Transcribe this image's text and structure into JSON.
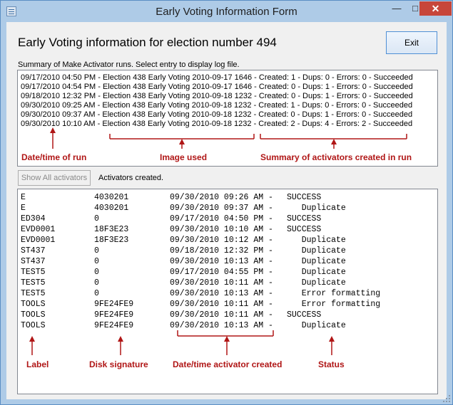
{
  "window": {
    "title": "Early Voting Information Form"
  },
  "heading": "Early Voting information for election number 494",
  "exit_label": "Exit",
  "summary_label": "Summary of Make Activator runs.  Select entry to display log file.",
  "runs": [
    "09/17/2010 04:50 PM - Election 438 Early Voting 2010-09-17 1646 - Created: 1 - Dups: 0 - Errors: 0 - Succeeded",
    "09/17/2010 04:54 PM - Election 438 Early Voting 2010-09-17 1646 - Created: 0 - Dups: 1 - Errors: 0 - Succeeded",
    "09/18/2010 12:32 PM - Election 438 Early Voting 2010-09-18 1232 - Created: 0 - Dups: 1 - Errors: 0 - Succeeded",
    "09/30/2010 09:25 AM - Election 438 Early Voting 2010-09-18 1232 - Created: 1 - Dups: 0 - Errors: 0 - Succeeded",
    "09/30/2010 09:37 AM - Election 438 Early Voting 2010-09-18 1232 - Created: 0 - Dups: 1 - Errors: 0 - Succeeded",
    "09/30/2010 10:10 AM - Election 438 Early Voting 2010-09-18 1232 - Created: 2 - Dups: 4 - Errors: 2 - Succeeded"
  ],
  "show_all_label": "Show All activators",
  "activators_label": "Activators created.",
  "activators": [
    {
      "label": "E",
      "sig": "4030201",
      "date": "09/30/2010 09:26 AM - ",
      "status": "SUCCESS"
    },
    {
      "label": "E",
      "sig": "4030201",
      "date": "09/30/2010 09:37 AM - ",
      "status": "   Duplicate"
    },
    {
      "label": "ED304",
      "sig": "0",
      "date": "09/17/2010 04:50 PM - ",
      "status": "SUCCESS"
    },
    {
      "label": "EVD0001",
      "sig": "18F3E23",
      "date": "09/30/2010 10:10 AM - ",
      "status": "SUCCESS"
    },
    {
      "label": "EVD0001",
      "sig": "18F3E23",
      "date": "09/30/2010 10:12 AM - ",
      "status": "   Duplicate"
    },
    {
      "label": "ST437",
      "sig": "0",
      "date": "09/18/2010 12:32 PM - ",
      "status": "   Duplicate"
    },
    {
      "label": "ST437",
      "sig": "0",
      "date": "09/30/2010 10:13 AM - ",
      "status": "   Duplicate"
    },
    {
      "label": "TEST5",
      "sig": "0",
      "date": "09/17/2010 04:55 PM - ",
      "status": "   Duplicate"
    },
    {
      "label": "TEST5",
      "sig": "0",
      "date": "09/30/2010 10:11 AM - ",
      "status": "   Duplicate"
    },
    {
      "label": "TEST5",
      "sig": "0",
      "date": "09/30/2010 10:13 AM - ",
      "status": "   Error formatting"
    },
    {
      "label": "TOOLS",
      "sig": "9FE24FE9",
      "date": "09/30/2010 10:11 AM - ",
      "status": "   Error formatting"
    },
    {
      "label": "TOOLS",
      "sig": "9FE24FE9",
      "date": "09/30/2010 10:11 AM - ",
      "status": "SUCCESS"
    },
    {
      "label": "TOOLS",
      "sig": "9FE24FE9",
      "date": "09/30/2010 10:13 AM - ",
      "status": "   Duplicate"
    }
  ],
  "annotations": {
    "date_time_of_run": "Date/time of run",
    "image_used": "Image used",
    "summary_of_activators": "Summary of activators created in run",
    "label": "Label",
    "disk_signature": "Disk signature",
    "date_time_created": "Date/time activator created",
    "status": "Status"
  },
  "colors": {
    "annotation": "#b01616",
    "titlebar": "#aecbe7",
    "close": "#c7463a"
  }
}
